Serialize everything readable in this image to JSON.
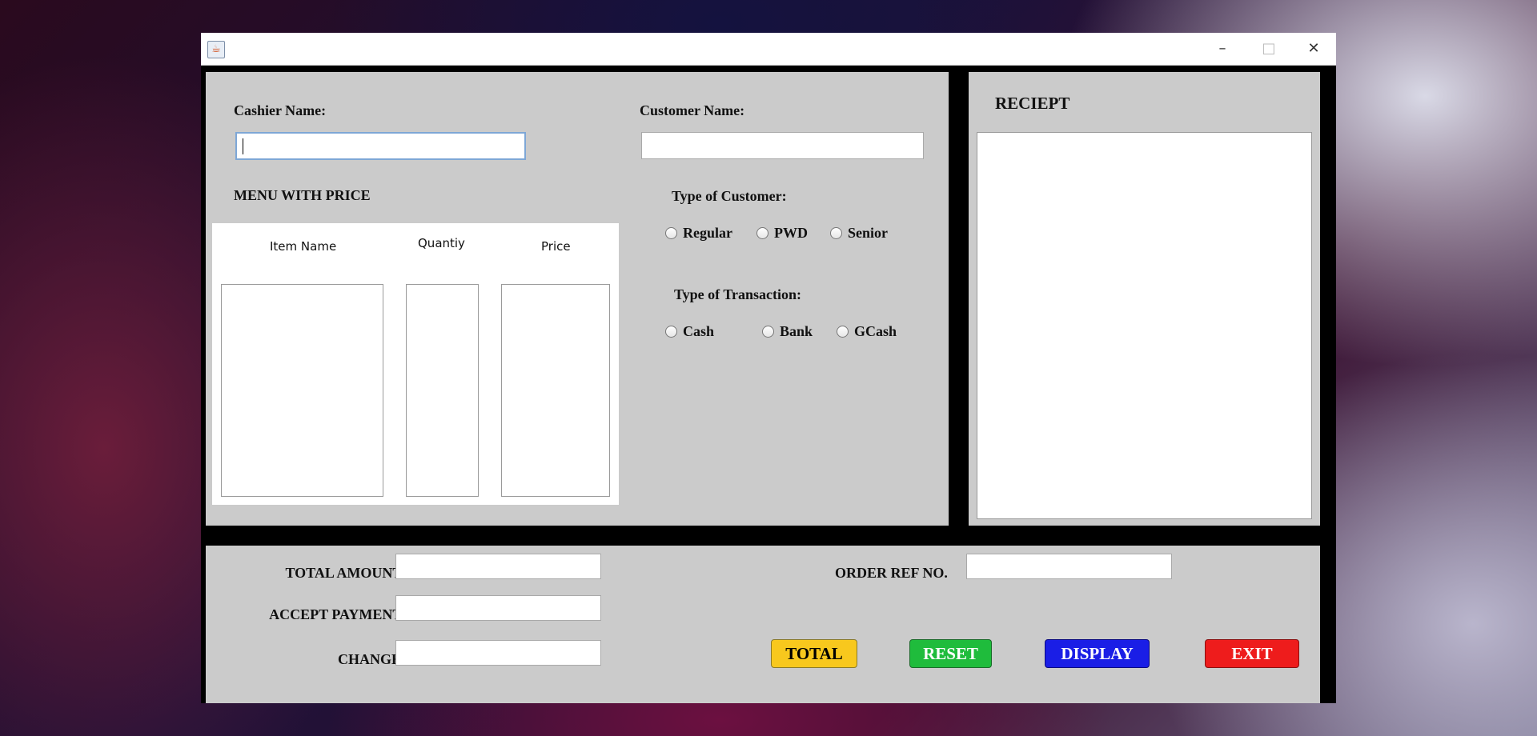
{
  "window": {
    "title": "",
    "app_icon": "java-icon",
    "minimize": "–",
    "maximize": "□",
    "close": "✕"
  },
  "cashier": {
    "label": "Cashier Name:",
    "value": ""
  },
  "customer": {
    "label": "Customer Name:",
    "value": ""
  },
  "menu": {
    "title": "MENU WITH PRICE",
    "columns": [
      "Item Name",
      "Quantiy",
      "Price"
    ]
  },
  "customer_type": {
    "label": "Type of Customer:",
    "options": [
      "Regular",
      "PWD",
      "Senior"
    ]
  },
  "transaction_type": {
    "label": "Type of Transaction:",
    "options": [
      "Cash",
      "Bank",
      "GCash"
    ]
  },
  "receipt": {
    "title": "RECIEPT",
    "content": ""
  },
  "totals": {
    "total_amount_label": "TOTAL AMOUNT:",
    "accept_payment_label": "ACCEPT PAYMENT:",
    "change_label": "CHANGE:",
    "order_ref_label": "ORDER REF NO."
  },
  "buttons": {
    "total": "TOTAL",
    "reset": "RESET",
    "display": "DISPLAY",
    "exit": "EXIT"
  },
  "colors": {
    "total": "#f8c81d",
    "reset": "#1fbc3c",
    "display": "#1a1ee6",
    "exit": "#ee1c1c",
    "panel": "#cbcbcb"
  }
}
